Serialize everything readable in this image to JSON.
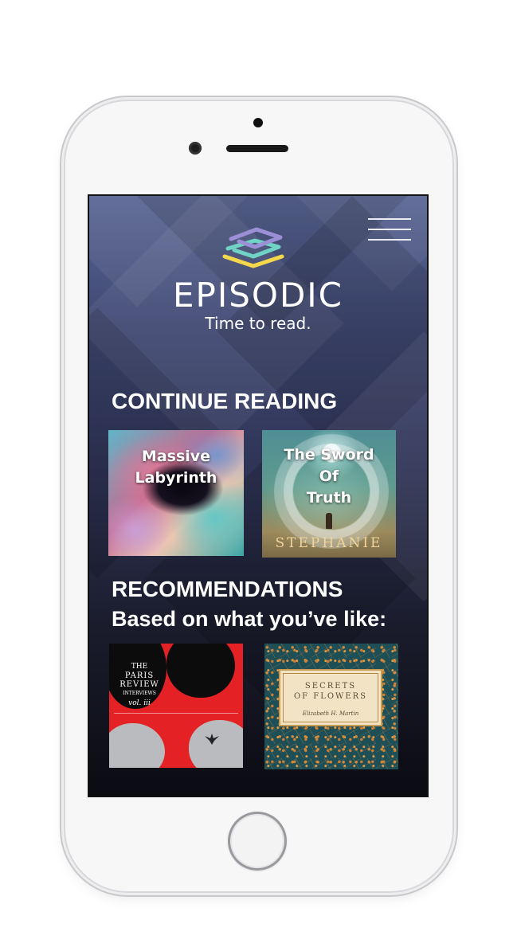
{
  "app": {
    "brand": "EPISODIC",
    "tagline": "Time to read."
  },
  "colors": {
    "logo_purple": "#9b8fd6",
    "logo_teal": "#6fd3c5",
    "logo_yellow": "#f3d84b",
    "screen_top": "#5a6694",
    "screen_bottom": "#0b0b12"
  },
  "header": {
    "menu_icon": "hamburger-menu-icon",
    "logo_icon": "stacked-layers-icon"
  },
  "continue_reading": {
    "title": "CONTINUE READING",
    "books": [
      {
        "title_line1": "Massive",
        "title_line2": "Labyrinth"
      },
      {
        "title_line1": "The Sword",
        "title_line2": "Of",
        "title_line3": "Truth",
        "author": "STEPHANIE"
      }
    ]
  },
  "recommendations": {
    "title": "RECOMMENDATIONS",
    "subtitle": "Based on what you’ve like:",
    "books": [
      {
        "title_small": "THE",
        "title_main_1": "PARIS",
        "title_main_2": "REVIEW",
        "title_sub": "INTERVIEWS",
        "volume": "vol. iii"
      },
      {
        "title_line1": "SECRETS",
        "title_line2": "OF FLOWERS",
        "author": "Elizabeth H. Martin"
      }
    ]
  }
}
